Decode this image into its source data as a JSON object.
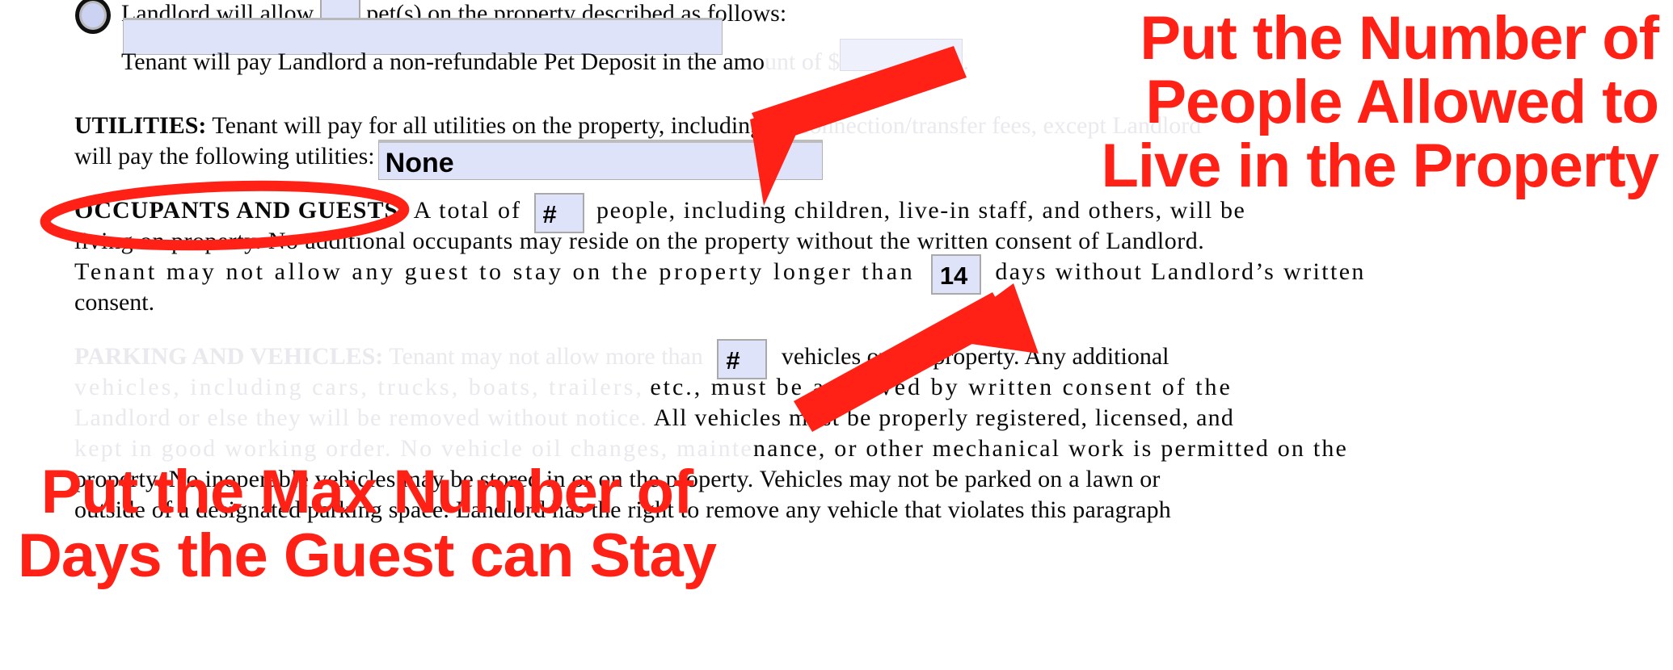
{
  "document": {
    "pet_line": {
      "prefix": "Landlord will allow",
      "suffix": "pet(s) on the property described as follows:",
      "count_value": "",
      "description_value": ""
    },
    "pet_deposit_line": {
      "text_visible": "Tenant will pay Landlord a non-refundable Pet Deposit in the amo",
      "text_faded": "unt of $",
      "text_tail": ".",
      "amount_value": ""
    },
    "utilities": {
      "heading": "UTILITIES:",
      "line1_visible": "Tenant will pay for all utilities on the property, including",
      "line1_faded": "all connection/transfer fees, except Landlord",
      "line2_label": "will pay the following utilities:",
      "value": "None"
    },
    "occupants": {
      "heading": "OCCUPANTS AND GUESTS:",
      "seg1": "A total of",
      "people_value": "#",
      "seg2": "people, including children, live-in staff, and others, will be",
      "line2": "living on property.  No additional occupants may reside on the property without the written consent of Landlord.",
      "line3a": "Tenant may not allow any guest to stay on the property longer than",
      "days_value": "14",
      "line3b": "days without Landlord’s written",
      "line4": "consent."
    },
    "parking": {
      "heading": "PARKING AND VEHICLES:",
      "seg1": "Tenant may not allow more than",
      "vehicles_value": "#",
      "seg2": "vehicles on the property. Any additional",
      "line2a": "vehicles, including cars, trucks, boats, trailers,",
      "line2b": "etc., must be approved by written consent of the",
      "line3a": "Landlord or else they will be removed without notice.",
      "line3b": "All vehicles must be properly registered, licensed, and",
      "line4a": "kept in good working order. No vehicle oil changes, mainte",
      "line4b": "nance, or other mechanical work is permitted on the",
      "line5": "property. No inoperable vehicles may be stored in or on the property. Vehicles may not be parked on a lawn or",
      "line6": "outside of a designated parking space. Landlord has the right to remove any vehicle that violates this paragraph"
    }
  },
  "annotations": {
    "color": "#ff2116",
    "top_caption": {
      "line1": "Put the Number of",
      "line2": "People Allowed to",
      "line3": "Live in the Property"
    },
    "bottom_caption": {
      "line1": "Put the Max Number of",
      "line2": "Days the Guest can Stay"
    },
    "ellipse_target": "OCCUPANTS AND GUESTS:",
    "arrow_top_target": "people-count-field",
    "arrow_bottom_target": "guest-days-field"
  },
  "colors": {
    "field_fill": "#dfe3fa",
    "field_border": "#a9a9a9",
    "annotation_red": "#ff2116",
    "faded_text": "#e9e9ee"
  }
}
